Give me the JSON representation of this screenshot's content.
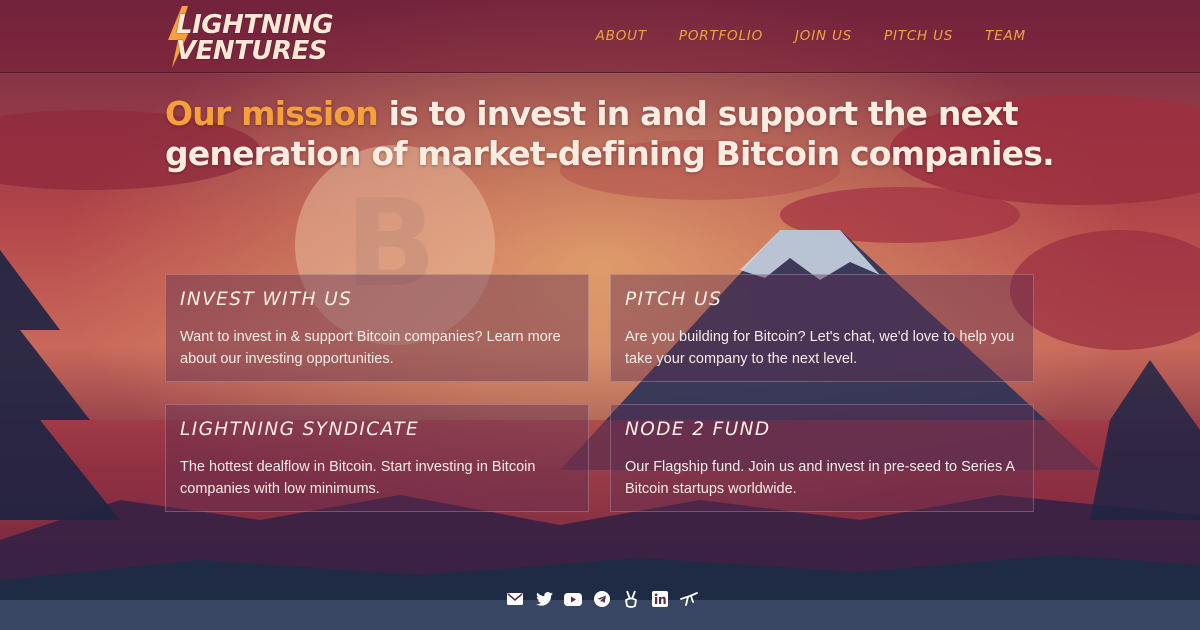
{
  "logo": {
    "line1": "LIGHTNING",
    "line2": "VENTURES"
  },
  "nav": {
    "about": "ABOUT",
    "portfolio": "PORTFOLIO",
    "join": "JOIN US",
    "pitch": "PITCH US",
    "team": "TEAM"
  },
  "mission": {
    "highlight": "Our mission",
    "rest": " is to invest in and support the next generation of market-defining Bitcoin companies."
  },
  "cards": [
    {
      "title": "INVEST WITH US",
      "text": "Want to invest in & support Bitcoin companies? Learn more about our investing opportunities."
    },
    {
      "title": "PITCH US",
      "text": "Are you building for Bitcoin? Let's chat, we'd love to help you take your company to the next level."
    },
    {
      "title": "LIGHTNING SYNDICATE",
      "text": "The hottest dealflow in Bitcoin. Start investing in Bitcoin companies with low minimums."
    },
    {
      "title": "NODE 2 FUND",
      "text": "Our Flagship fund. Join us and invest in pre-seed to Series A Bitcoin startups worldwide."
    }
  ],
  "social_icons": [
    "email-icon",
    "twitter-icon",
    "youtube-icon",
    "telegram-icon",
    "nostr-icon",
    "linkedin-icon",
    "angellist-icon"
  ],
  "colors": {
    "accent": "#f6a03c",
    "text": "#fbece1",
    "header_bg": "#7a1e37"
  }
}
